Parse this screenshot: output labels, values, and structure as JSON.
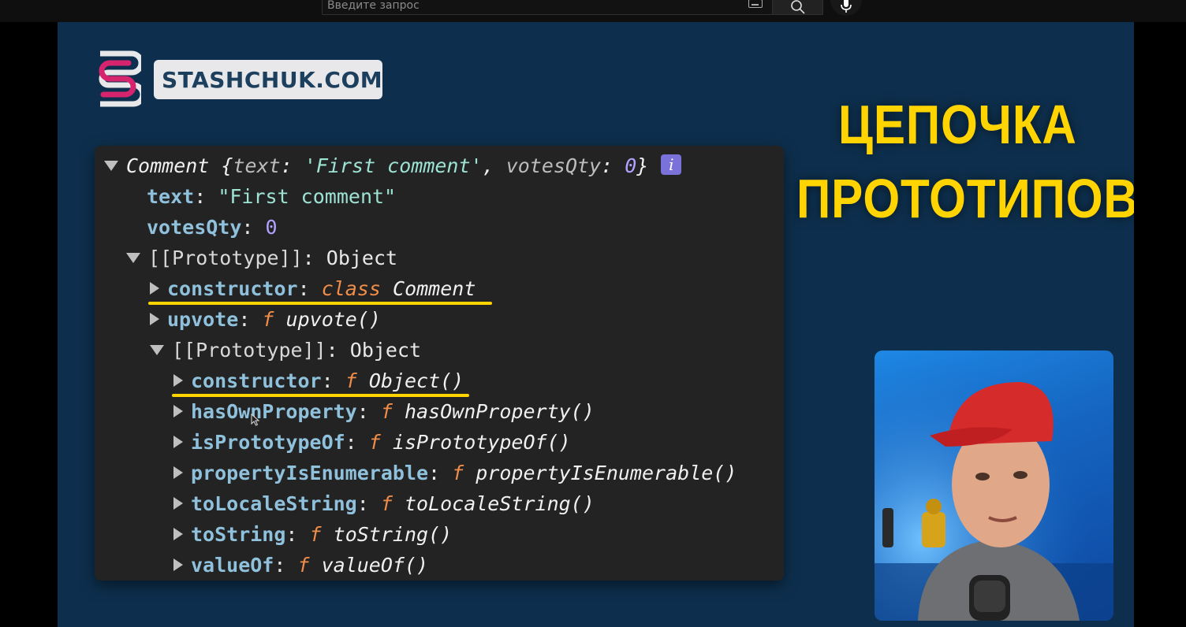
{
  "search": {
    "placeholder": "Введите запрос"
  },
  "logo": {
    "text": "STASHCHUK.COM"
  },
  "title": {
    "line1": "ЦЕПОЧКА",
    "line2": "ПРОТОТИПОВ"
  },
  "console": {
    "root": {
      "name": "Comment",
      "open": "{",
      "k1": "text",
      "v1": "'First comment'",
      "k2": "votesQty",
      "v2": "0",
      "close": "}",
      "info": "i"
    },
    "text_key": "text",
    "text_val": "\"First comment\"",
    "votes_key": "votesQty",
    "votes_val": "0",
    "proto1": {
      "key": "[[Prototype]]",
      "val": "Object"
    },
    "constructor1": {
      "key": "constructor",
      "kw": "class",
      "name": "Comment"
    },
    "upvote": {
      "key": "upvote",
      "f": "f",
      "name": "upvote()"
    },
    "proto2": {
      "key": "[[Prototype]]",
      "val": "Object"
    },
    "methods": [
      {
        "key": "constructor",
        "f": "f",
        "name": "Object()"
      },
      {
        "key": "hasOwnProperty",
        "f": "f",
        "name": "hasOwnProperty()"
      },
      {
        "key": "isPrototypeOf",
        "f": "f",
        "name": "isPrototypeOf()"
      },
      {
        "key": "propertyIsEnumerable",
        "f": "f",
        "name": "propertyIsEnumerable()"
      },
      {
        "key": "toLocaleString",
        "f": "f",
        "name": "toLocaleString()"
      },
      {
        "key": "toString",
        "f": "f",
        "name": "toString()"
      },
      {
        "key": "valueOf",
        "f": "f",
        "name": "valueOf()"
      }
    ]
  },
  "colors": {
    "accent_yellow": "#ffd400",
    "panel_bg": "#232323",
    "video_bg": "#0d2f4d"
  }
}
